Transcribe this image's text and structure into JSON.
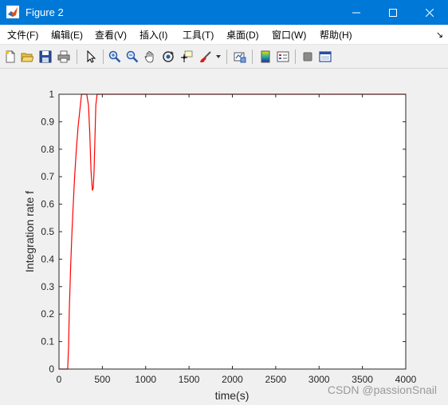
{
  "window": {
    "title": "Figure 2"
  },
  "menubar": {
    "items": [
      {
        "label": "文件(F)"
      },
      {
        "label": "编辑(E)"
      },
      {
        "label": "查看(V)"
      },
      {
        "label": "插入(I)"
      },
      {
        "label": "工具(T)"
      },
      {
        "label": "桌面(D)"
      },
      {
        "label": "窗口(W)"
      },
      {
        "label": "帮助(H)"
      }
    ],
    "overflow_icon": "collapse-arrow-icon"
  },
  "toolbar": {
    "buttons": [
      "new-figure-icon",
      "open-file-icon",
      "save-icon",
      "print-icon",
      "edit-plot-arrow-icon",
      "zoom-in-icon",
      "zoom-out-icon",
      "pan-hand-icon",
      "rotate-3d-icon",
      "data-cursor-icon",
      "brush-icon",
      "link-plot-icon",
      "colorbar-icon",
      "legend-icon",
      "hide-plot-tools-icon",
      "show-plot-tools-icon"
    ]
  },
  "chart_data": {
    "type": "line",
    "title": "",
    "xlabel": "time(s)",
    "ylabel": "Integration rate f",
    "xlim": [
      0,
      4000
    ],
    "ylim": [
      0,
      1
    ],
    "xticks": [
      "0",
      "500",
      "1000",
      "1500",
      "2000",
      "2500",
      "3000",
      "3500",
      "4000"
    ],
    "yticks": [
      "0",
      "0.1",
      "0.2",
      "0.3",
      "0.4",
      "0.5",
      "0.6",
      "0.7",
      "0.8",
      "0.9",
      "1"
    ],
    "grid": false,
    "series": [
      {
        "color": "#ff0000",
        "x": [
          0,
          100,
          110,
          120,
          135,
          150,
          165,
          180,
          200,
          220,
          240,
          260,
          290,
          320,
          340,
          355,
          370,
          385,
          395,
          405,
          415,
          425,
          440,
          460,
          500,
          1000,
          2000,
          3000,
          4000
        ],
        "y": [
          0,
          0,
          0.08,
          0.22,
          0.38,
          0.5,
          0.6,
          0.7,
          0.8,
          0.88,
          0.94,
          1.0,
          1.0,
          1.0,
          0.96,
          0.86,
          0.72,
          0.65,
          0.66,
          0.72,
          0.84,
          0.96,
          1.0,
          1.0,
          1.0,
          1.0,
          1.0,
          1.0,
          1.0
        ]
      }
    ]
  },
  "watermark": "CSDN @passionSnail"
}
